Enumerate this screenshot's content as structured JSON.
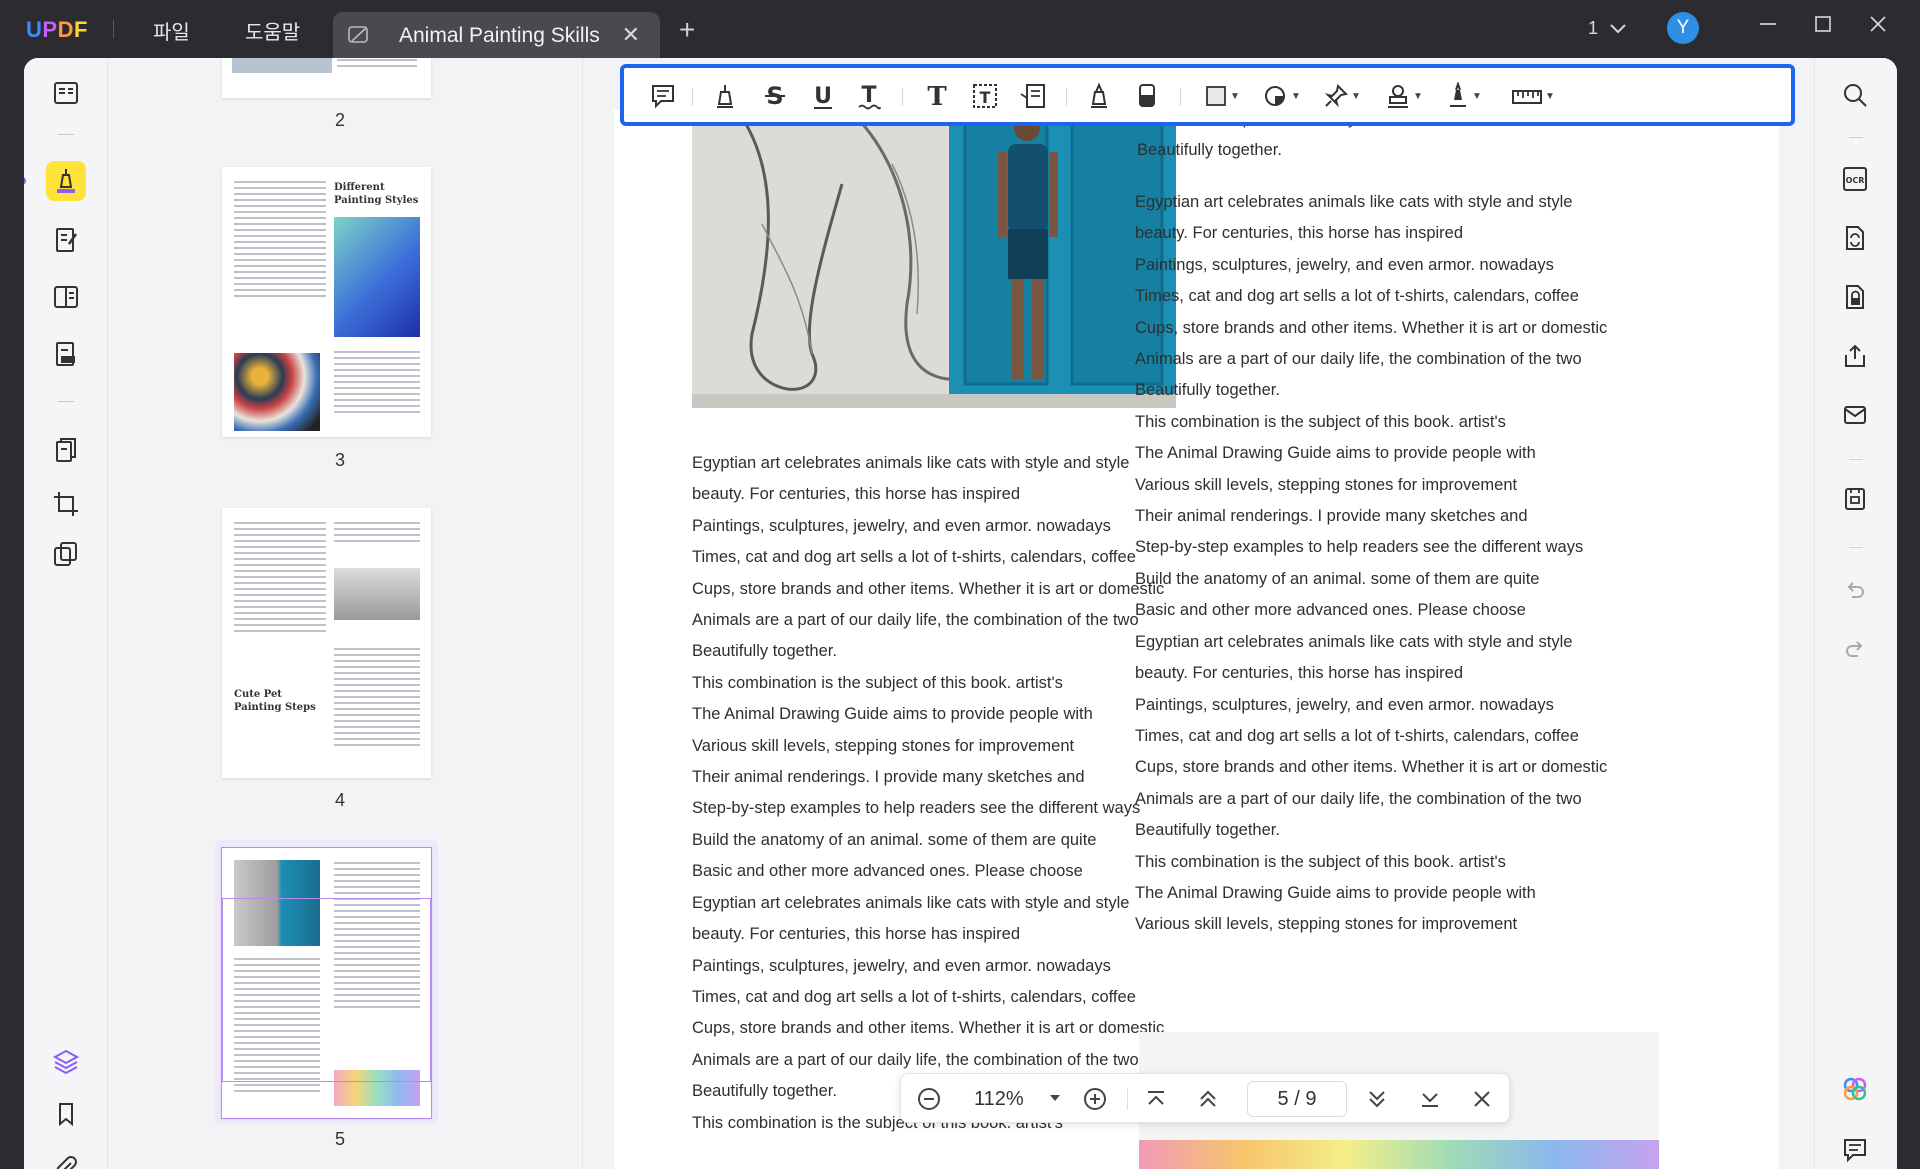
{
  "app": {
    "logo": "UPDF",
    "menu": [
      "파일",
      "도움말"
    ],
    "tab_title": "Animal Painting Skills",
    "tab_close": "✕",
    "new_tab": "+",
    "page_indicator": "1",
    "avatar_letter": "Y"
  },
  "thumbnails": {
    "pages": [
      {
        "label": "2"
      },
      {
        "label": "3",
        "heading": "Different Painting Styles"
      },
      {
        "label": "4",
        "heading": "Cute Pet Painting Steps"
      },
      {
        "label": "5"
      }
    ]
  },
  "document": {
    "left_column": [
      "Egyptian art celebrates animals like cats with style and style",
      "beauty. For centuries, this horse has inspired",
      "Paintings, sculptures, jewelry, and even armor. nowadays",
      "Times, cat and dog art sells a lot of t-shirts, calendars, coffee",
      "Cups, store brands and other items. Whether it is art or domestic",
      "Animals are a part of our daily life, the combination of the two",
      "Beautifully together.",
      "This combination is the subject of this book. artist's",
      "The Animal Drawing Guide aims to provide people with",
      "Various skill levels, stepping stones for improvement",
      "Their animal renderings. I provide many sketches and",
      "Step-by-step examples to help readers see the different ways",
      "Build the anatomy of an animal. some of them are quite",
      "Basic and other more advanced ones. Please choose",
      "Egyptian art celebrates animals like cats with style and style",
      "beauty. For centuries, this horse has inspired",
      "Paintings, sculptures, jewelry, and even armor. nowadays",
      "Times, cat and dog art sells a lot of t-shirts, calendars, coffee",
      "Cups, store brands and other items. Whether it is art or domestic",
      "Animals are a part of our daily life, the combination of the two",
      "Beautifully together.",
      "This combination is the subject of this book. artist's"
    ],
    "right_column_top": [
      "Animals are a part of our daily life, the combination of the two",
      "Beautifully together."
    ],
    "right_column": [
      "Egyptian art celebrates animals like cats with style and style",
      "beauty. For centuries, this horse has inspired",
      "Paintings, sculptures, jewelry, and even armor. nowadays",
      "Times, cat and dog art sells a lot of t-shirts, calendars, coffee",
      "Cups, store brands and other items. Whether it is art or domestic",
      "Animals are a part of our daily life, the combination of the two",
      "Beautifully together.",
      "This combination is the subject of this book. artist's",
      "The Animal Drawing Guide aims to provide people with",
      "Various skill levels, stepping stones for improvement",
      "Their animal renderings. I provide many sketches and",
      "Step-by-step examples to help readers see the different ways",
      "Build the anatomy of an animal. some of them are quite",
      "Basic and other more advanced ones. Please choose",
      "Egyptian art celebrates animals like cats with style and style",
      "beauty. For centuries, this horse has inspired",
      "Paintings, sculptures, jewelry, and even armor. nowadays",
      "Times, cat and dog art sells a lot of t-shirts, calendars, coffee",
      "Cups, store brands and other items. Whether it is art or domestic",
      "Animals are a part of our daily life, the combination of the two",
      "Beautifully together.",
      "This combination is the subject of this book. artist's",
      "The Animal Drawing Guide aims to provide people with",
      "Various skill levels, stepping stones for improvement"
    ]
  },
  "zoom": {
    "value": "112%",
    "page": "5 / 9"
  },
  "colors": {
    "toolbar_border": "#1e64f0",
    "active_tool": "#ffe23a",
    "avatar": "#2f8fe6",
    "accent_purple": "#8b5cf6"
  }
}
